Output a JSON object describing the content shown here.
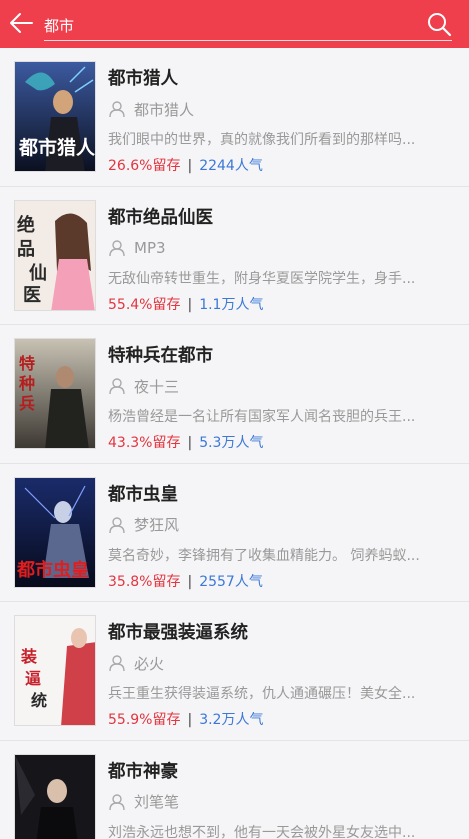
{
  "header": {
    "back_icon": "arrow-left-icon",
    "search_value": "都市",
    "search_icon": "search-icon",
    "bg_color": "#ef3f4d"
  },
  "colors": {
    "retention": "#e3353f",
    "popularity": "#3b78d8"
  },
  "books": [
    {
      "title": "都市猎人",
      "author": "都市猎人",
      "desc": "我们眼中的世界，真的就像我们所看到的那样吗...",
      "retention": "26.6%留存",
      "popularity": "2244人气",
      "cover_icon": "book-cover-image"
    },
    {
      "title": "都市绝品仙医",
      "author": "MP3",
      "desc": "无敌仙帝转世重生，附身华夏医学院学生，身手...",
      "retention": "55.4%留存",
      "popularity": "1.1万人气",
      "cover_icon": "book-cover-image"
    },
    {
      "title": "特种兵在都市",
      "author": "夜十三",
      "desc": "杨浩曾经是一名让所有国家军人闻名丧胆的兵王...",
      "retention": "43.3%留存",
      "popularity": "5.3万人气",
      "cover_icon": "book-cover-image"
    },
    {
      "title": "都市虫皇",
      "author": "梦狂风",
      "desc": "莫名奇妙，李锋拥有了收集血精能力。 饲养蚂蚁...",
      "retention": "35.8%留存",
      "popularity": "2557人气",
      "cover_icon": "book-cover-image"
    },
    {
      "title": "都市最强装逼系统",
      "author": "必火",
      "desc": "兵王重生获得装逼系统，仇人通通碾压！美女全...",
      "retention": "55.9%留存",
      "popularity": "3.2万人气",
      "cover_icon": "book-cover-image"
    },
    {
      "title": "都市神豪",
      "author": "刘笔笔",
      "desc": "刘浩永远也想不到，他有一天会被外星女友选中...",
      "retention": "",
      "popularity": "",
      "cover_icon": "book-cover-image"
    }
  ]
}
